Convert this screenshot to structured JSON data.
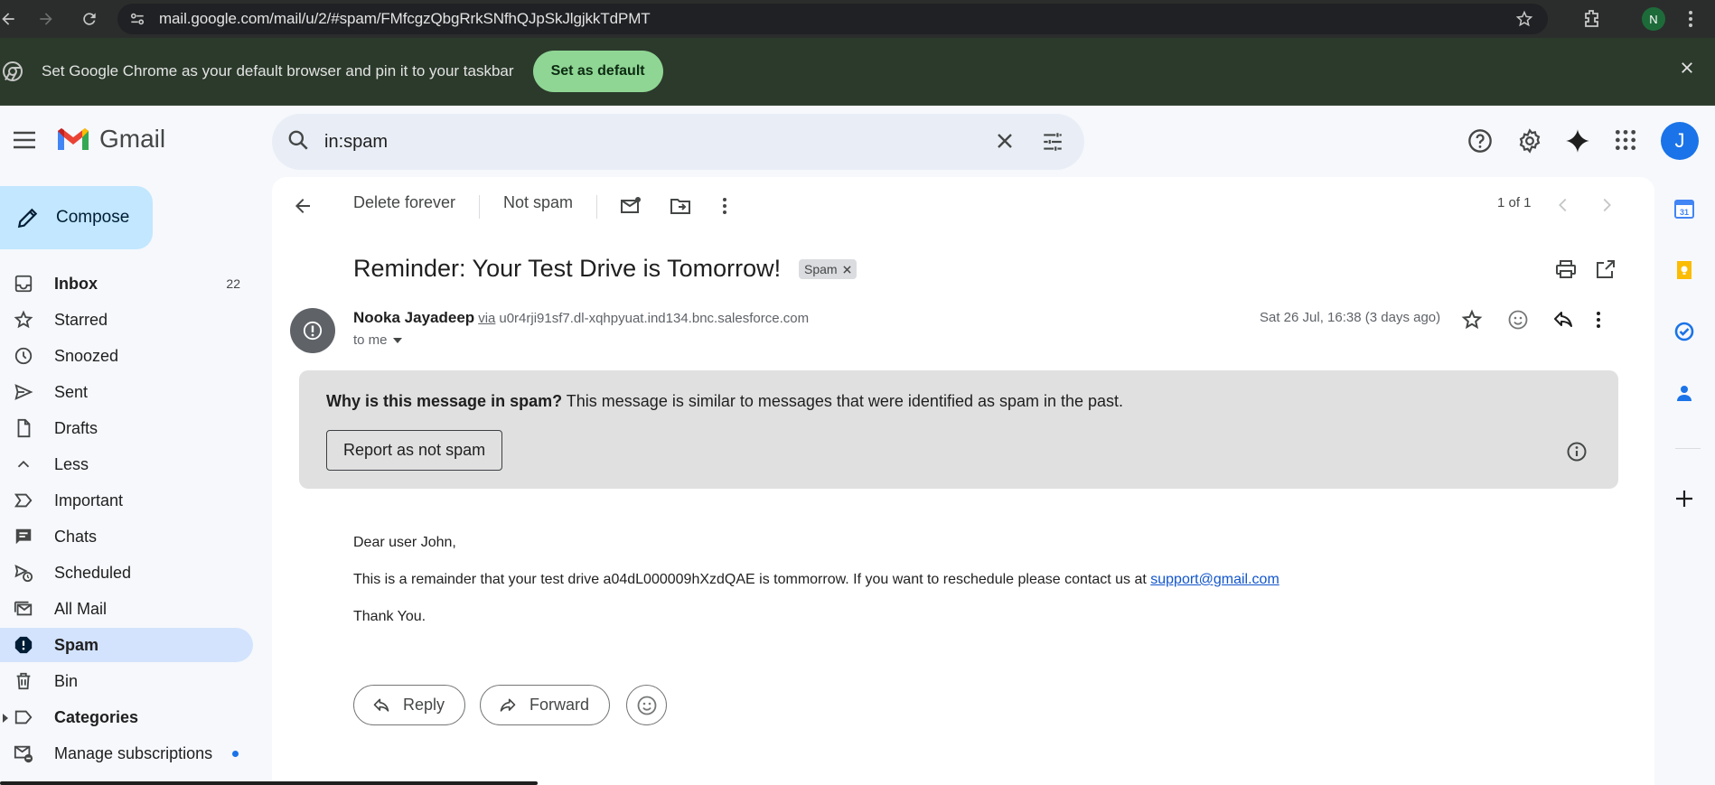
{
  "browser": {
    "url": "mail.google.com/mail/u/2/#spam/FMfcgzQbgRrkSNfhQJpSkJlgjkkTdPMT",
    "profile_initial": "N"
  },
  "banner": {
    "message": "Set Google Chrome as your default browser and pin it to your taskbar",
    "button": "Set as default"
  },
  "header": {
    "app_name": "Gmail",
    "search_query": "in:spam",
    "account_initial": "J"
  },
  "sidebar": {
    "compose_label": "Compose",
    "items": [
      {
        "label": "Inbox",
        "count": "22",
        "icon": "inbox-icon",
        "bold": true
      },
      {
        "label": "Starred",
        "icon": "star-icon"
      },
      {
        "label": "Snoozed",
        "icon": "clock-icon"
      },
      {
        "label": "Sent",
        "icon": "send-icon"
      },
      {
        "label": "Drafts",
        "icon": "draft-icon"
      },
      {
        "label": "Less",
        "icon": "chevron-up-icon"
      },
      {
        "label": "Important",
        "icon": "important-icon"
      },
      {
        "label": "Chats",
        "icon": "chat-icon"
      },
      {
        "label": "Scheduled",
        "icon": "scheduled-icon"
      },
      {
        "label": "All Mail",
        "icon": "all-mail-icon"
      },
      {
        "label": "Spam",
        "icon": "spam-icon",
        "active": true,
        "bold": true
      },
      {
        "label": "Bin",
        "icon": "trash-icon"
      },
      {
        "label": "Categories",
        "icon": "label-icon",
        "bold": true
      },
      {
        "label": "Manage subscriptions",
        "icon": "subscriptions-icon"
      }
    ]
  },
  "toolbar": {
    "delete_forever": "Delete forever",
    "not_spam": "Not spam",
    "pager": "1 of 1"
  },
  "email": {
    "subject": "Reminder: Your Test Drive is Tomorrow!",
    "label_chip": "Spam",
    "sender_name": "Nooka Jayadeep",
    "via": "via",
    "sender_domain": "u0r4rji91sf7.dl-xqhpyuat.ind134.bnc.salesforce.com",
    "to": "to me",
    "date": "Sat 26 Jul, 16:38 (3 days ago)",
    "spam_warning_bold": "Why is this message in spam?",
    "spam_warning_text": "This message is similar to messages that were identified as spam in the past.",
    "report_button": "Report as not spam",
    "greeting": "Dear user John,",
    "body_line": "This is a remainder that your test drive a04dL000009hXzdQAE is tommorrow. If you want to reschedule please contact us at",
    "link": "support@gmail.com",
    "signoff": "Thank You."
  },
  "actions": {
    "reply": "Reply",
    "forward": "Forward"
  }
}
